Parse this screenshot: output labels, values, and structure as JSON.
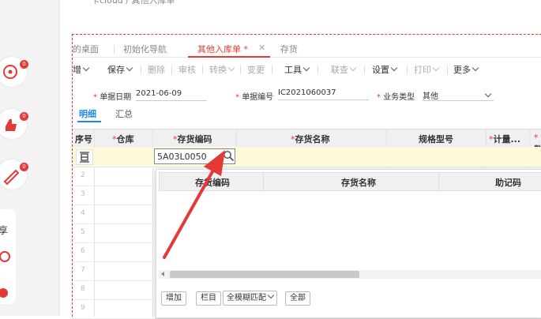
{
  "crumb": "卡cloud / 其他入库单",
  "tabs": [
    {
      "label": "的桌面"
    },
    {
      "label": "初始化导航"
    },
    {
      "label": "其他入库单 *"
    },
    {
      "label": "存货"
    }
  ],
  "toolbar": {
    "items": [
      "增",
      "保存",
      "删除",
      "审核",
      "转换",
      "变更",
      "工具",
      "联查",
      "设置",
      "打印",
      "更多"
    ]
  },
  "form": {
    "date_label": "单据日期",
    "date_value": "2021-06-09",
    "no_label": "单据编号",
    "no_value": "IC2021060037",
    "biz_label": "业务类型",
    "biz_value": "其他"
  },
  "subtabs": [
    "明细",
    "汇总"
  ],
  "grid": {
    "headers": [
      "序号",
      "仓库",
      "存货编码",
      "存货名称",
      "规格型号",
      "计量...",
      "数"
    ],
    "row_numbers": [
      "2",
      "3",
      "4",
      "5",
      "6",
      "7",
      "8",
      "9"
    ],
    "input_value": "5A03L0050"
  },
  "dropdown": {
    "headers": [
      "存货编码",
      "存货名称",
      "助记码"
    ],
    "buttons": {
      "add": "增加",
      "columns": "栏目",
      "match": "全模糊匹配",
      "all": "全部"
    }
  },
  "annotation_color": "#e53935"
}
